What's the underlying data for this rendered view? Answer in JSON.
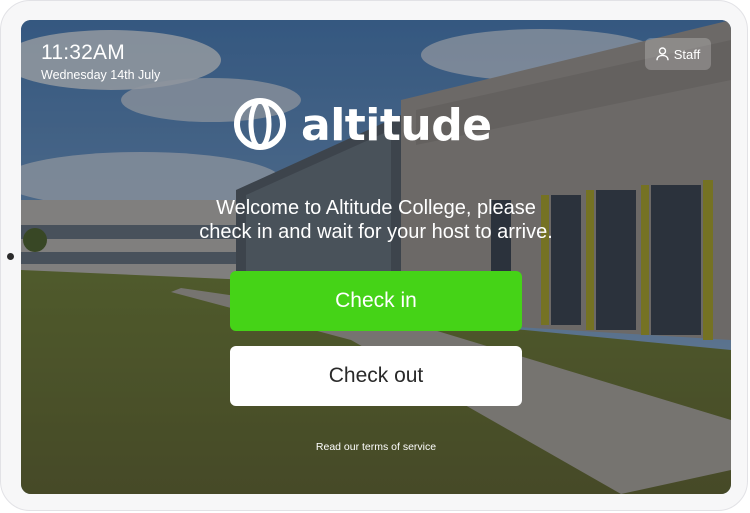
{
  "clock": {
    "time": "11:32AM",
    "date": "Wednesday 14th July"
  },
  "staff_button": {
    "label": "Staff",
    "icon": "person-icon"
  },
  "logo": {
    "wordmark": "altitude",
    "icon": "globe-icon"
  },
  "welcome": {
    "line1": "Welcome to Altitude College, please",
    "line2": "check in and wait for your host to arrive."
  },
  "actions": {
    "check_in_label": "Check in",
    "check_out_label": "Check out"
  },
  "footer": {
    "terms_link": "Read our terms of service"
  },
  "colors": {
    "check_in": "#45d317",
    "check_out": "#ffffff",
    "text": "#ffffff"
  }
}
